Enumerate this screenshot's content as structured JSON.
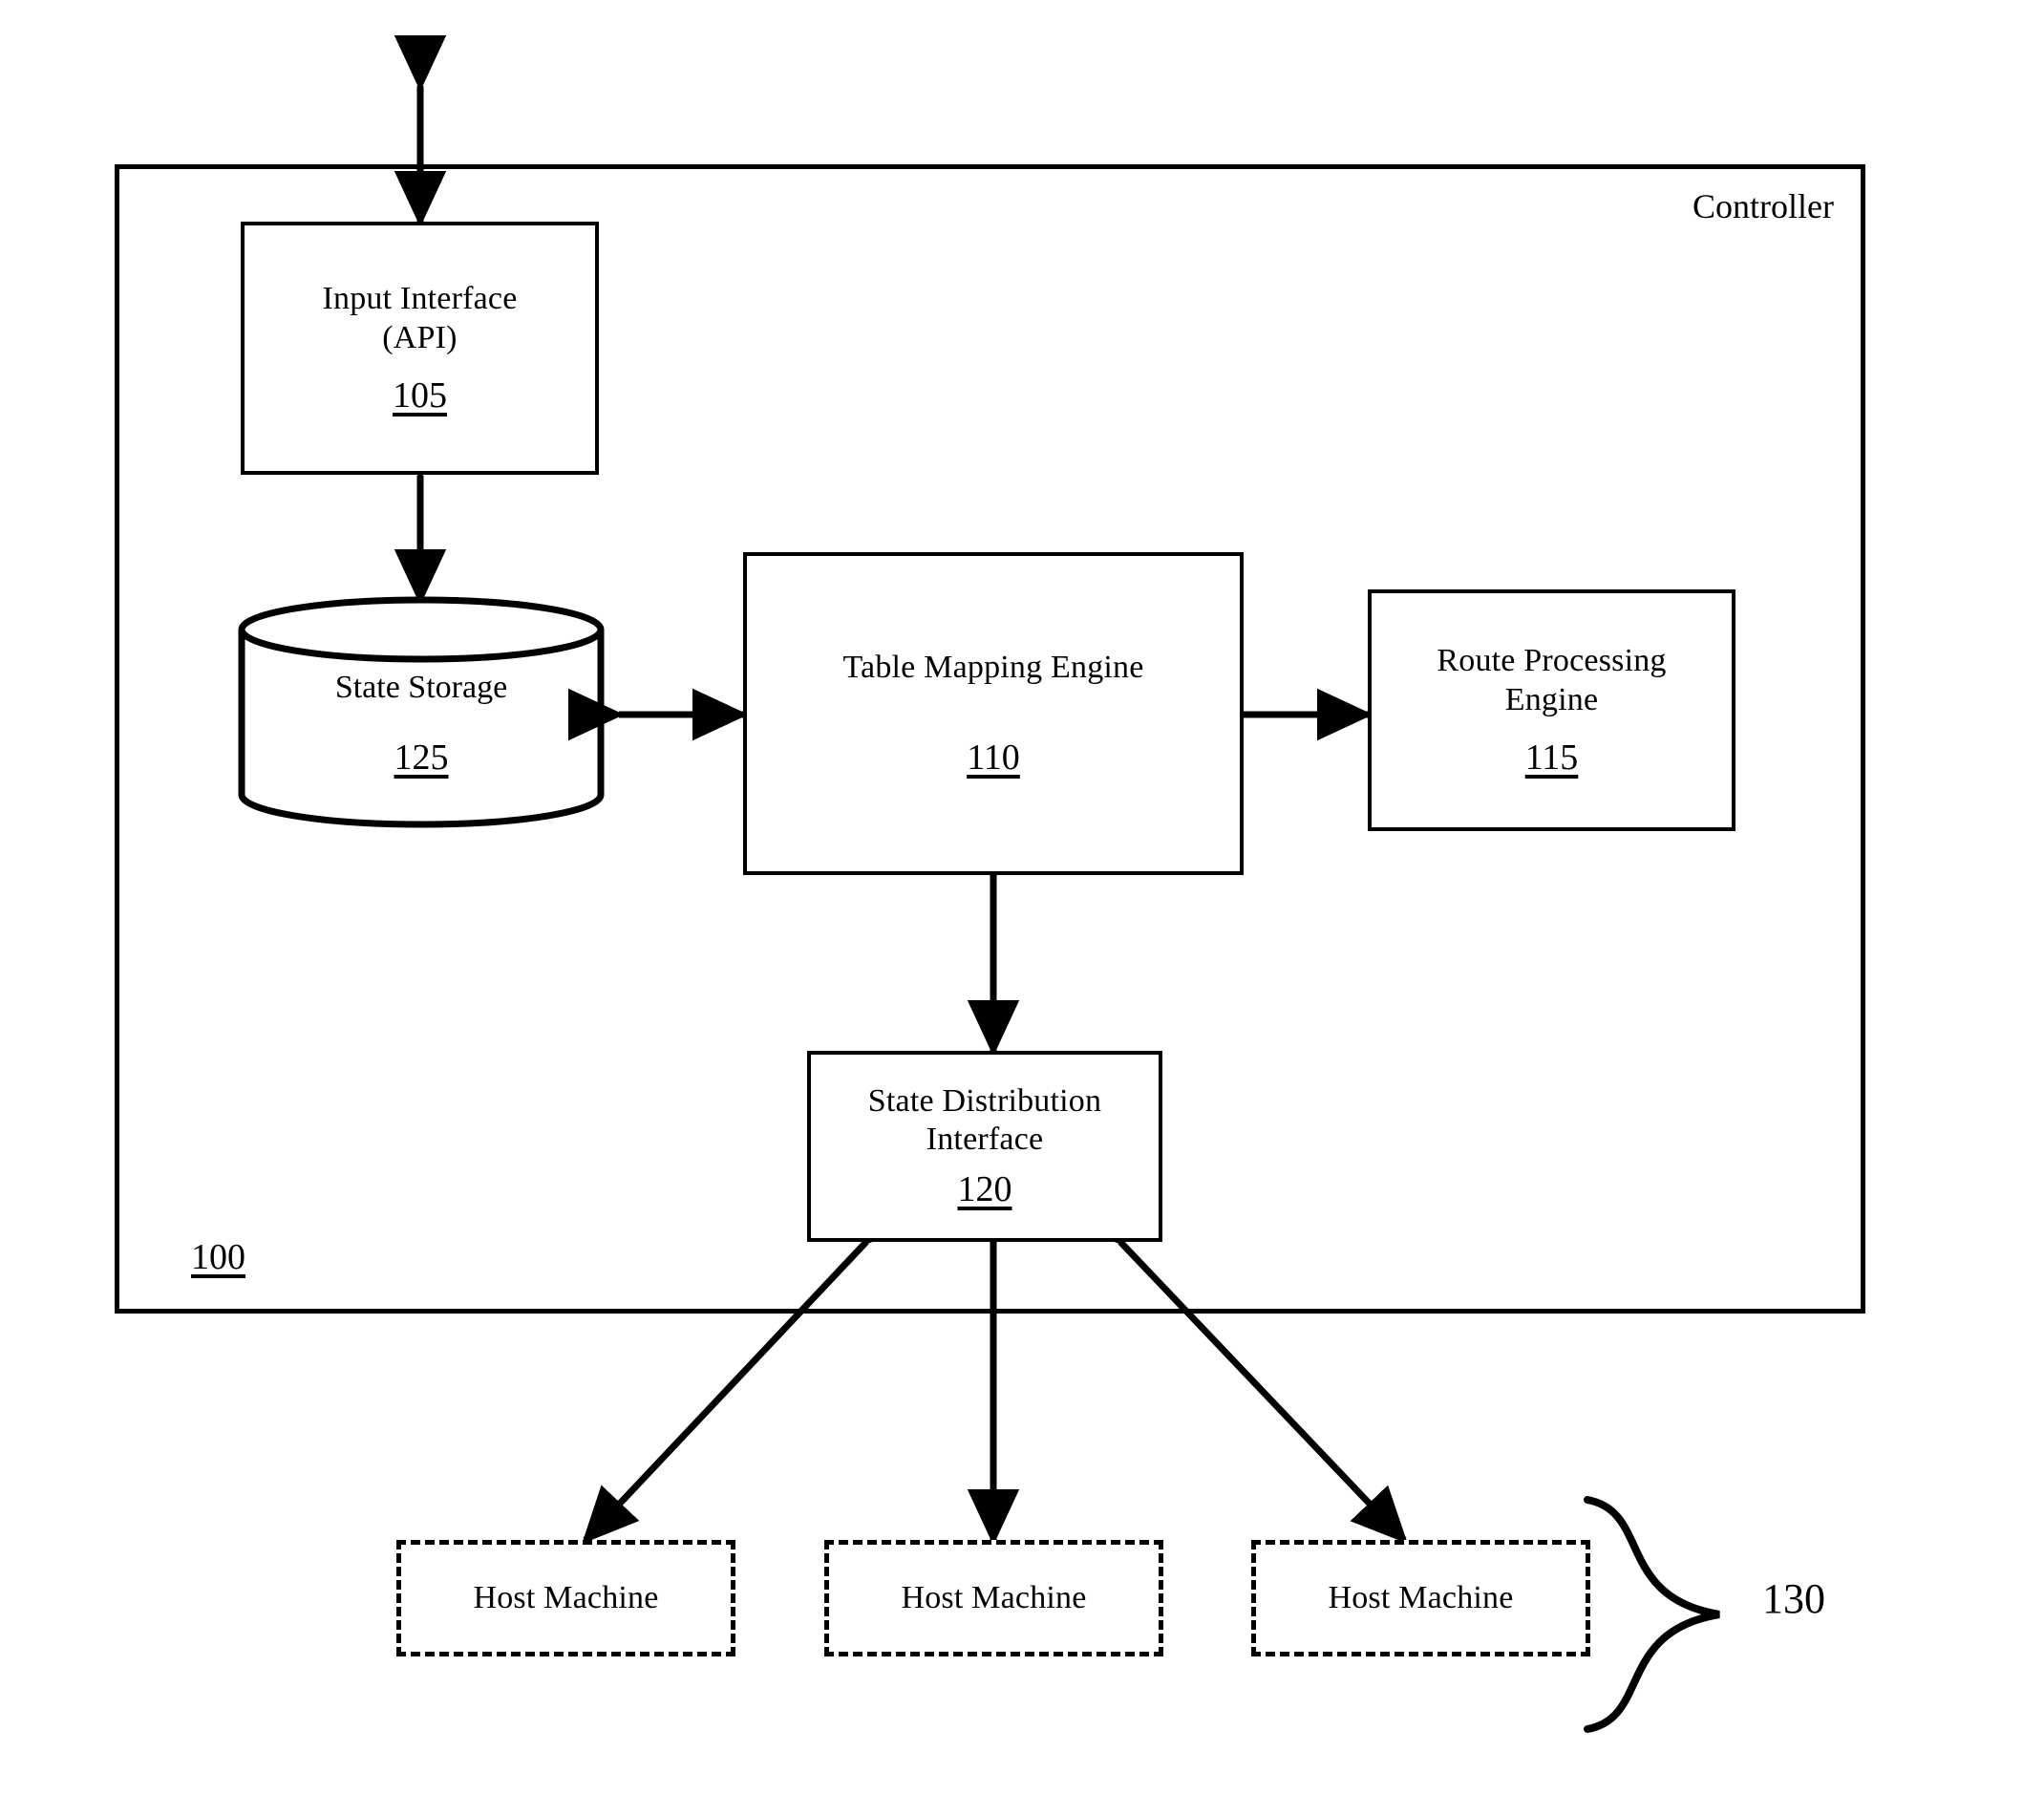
{
  "figure": {
    "controller": {
      "label": "Controller",
      "refnum": "100"
    },
    "nodes": [
      {
        "id": "input-interface",
        "title": "Input Interface\n(API)",
        "refnum": "105",
        "shape": "rectangle"
      },
      {
        "id": "state-storage",
        "title": "State Storage",
        "refnum": "125",
        "shape": "cylinder"
      },
      {
        "id": "table-mapping-engine",
        "title": "Table Mapping Engine",
        "refnum": "110",
        "shape": "rectangle"
      },
      {
        "id": "route-processing-engine",
        "title": "Route Processing\nEngine",
        "refnum": "115",
        "shape": "rectangle"
      },
      {
        "id": "state-distribution-interface",
        "title": "State Distribution\nInterface",
        "refnum": "120",
        "shape": "rectangle"
      }
    ],
    "host_machines": {
      "group_refnum": "130",
      "items": [
        {
          "id": "host-machine-1",
          "label": "Host Machine"
        },
        {
          "id": "host-machine-2",
          "label": "Host Machine"
        },
        {
          "id": "host-machine-3",
          "label": "Host Machine"
        }
      ]
    },
    "connections": [
      {
        "from": "external-top",
        "to": "input-interface",
        "type": "bidirectional"
      },
      {
        "from": "input-interface",
        "to": "state-storage",
        "type": "bidirectional"
      },
      {
        "from": "state-storage",
        "to": "table-mapping-engine",
        "type": "bidirectional"
      },
      {
        "from": "table-mapping-engine",
        "to": "route-processing-engine",
        "type": "bidirectional"
      },
      {
        "from": "table-mapping-engine",
        "to": "state-distribution-interface",
        "type": "bidirectional"
      },
      {
        "from": "state-distribution-interface",
        "to": "host-machine-1",
        "type": "bidirectional"
      },
      {
        "from": "state-distribution-interface",
        "to": "host-machine-2",
        "type": "bidirectional"
      },
      {
        "from": "state-distribution-interface",
        "to": "host-machine-3",
        "type": "bidirectional"
      }
    ],
    "colors": {
      "stroke": "#000000",
      "background": "#ffffff"
    }
  }
}
